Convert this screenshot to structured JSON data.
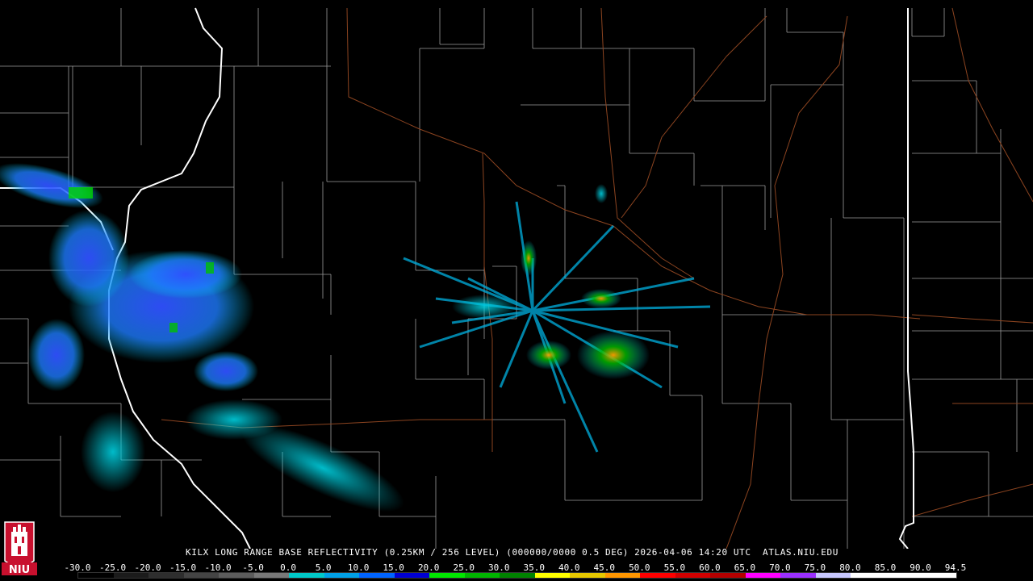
{
  "product": {
    "caption": "KILX LONG RANGE BASE REFLECTIVITY (0.25KM / 256 LEVEL) (000000/0000 0.5 DEG) 2026-04-06 14:20 UTC  ATLAS.NIU.EDU",
    "logo_text": "NIU"
  },
  "legend": {
    "ticks": [
      "-30.0",
      "-25.0",
      "-20.0",
      "-15.0",
      "-10.0",
      "-5.0",
      "0.0",
      "5.0",
      "10.0",
      "15.0",
      "20.0",
      "25.0",
      "30.0",
      "35.0",
      "40.0",
      "45.0",
      "50.0",
      "55.0",
      "60.0",
      "65.0",
      "70.0",
      "75.0",
      "80.0",
      "85.0",
      "90.0",
      "94.5"
    ],
    "colors": [
      "#000000",
      "#1b1b1b",
      "#2e2e2e",
      "#444444",
      "#5c5c5c",
      "#787878",
      "#00c8c8",
      "#00a0e6",
      "#0064ff",
      "#0000d2",
      "#00e600",
      "#00b400",
      "#008200",
      "#ffff00",
      "#e6c800",
      "#ff9600",
      "#ff0000",
      "#d20000",
      "#b40000",
      "#ff00ff",
      "#9b30ff",
      "#c8c8ff",
      "#ffffff",
      "#ffffff",
      "#ffffff"
    ]
  },
  "colors": {
    "state_border": "#ffffff",
    "county_border": "#9a9a9a",
    "highway": "#9a4a20"
  }
}
